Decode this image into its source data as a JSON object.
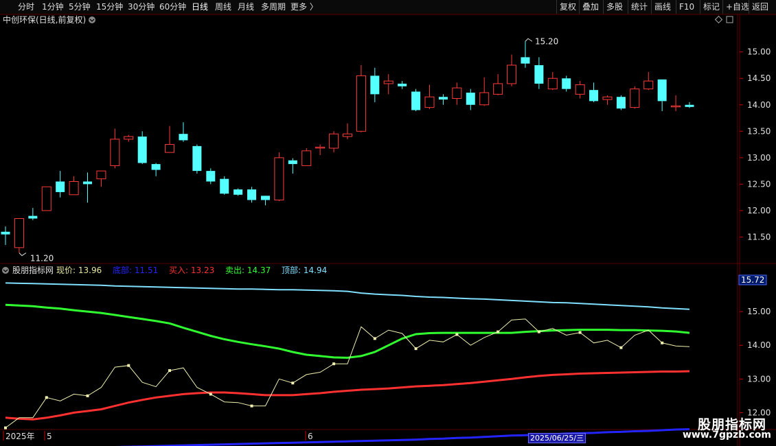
{
  "toolbar": {
    "left": [
      "分时",
      "1分钟",
      "5分钟",
      "15分钟",
      "30分钟",
      "60分钟",
      "日线",
      "周线",
      "月线",
      "多周期",
      "更多 〉"
    ],
    "active_index": 6,
    "right": [
      "复权",
      "叠加",
      "多股",
      "统计",
      "画线",
      "F10",
      "标记",
      "+自选",
      "返回"
    ]
  },
  "stock": {
    "title": "中创环保(日线,前复权)",
    "high_marker": "15.20",
    "low_marker": "11.20"
  },
  "indicator": {
    "name": "股朋指标网",
    "items": [
      {
        "label": "现价:",
        "value": "13.96",
        "color": "#e8e8a0"
      },
      {
        "label": "底部:",
        "value": "11.51",
        "color": "#2424ff"
      },
      {
        "label": "买入:",
        "value": "13.23",
        "color": "#ff3030"
      },
      {
        "label": "卖出:",
        "value": "14.37",
        "color": "#30ff30"
      },
      {
        "label": "顶部:",
        "value": "14.94",
        "color": "#80e0ff"
      }
    ],
    "current_badge": "15.72"
  },
  "axis": {
    "date_labels": [
      "2025年",
      "5",
      "6"
    ],
    "date_badge": "2025/06/25/三"
  },
  "brand": {
    "name": "股朋指标网",
    "url": "www.7gpzb.com"
  },
  "colors": {
    "up": "#ff3a3a",
    "down": "#54ffff",
    "grid": "#5a0000",
    "bg": "#000000"
  },
  "chart_data": {
    "type": "candlestick",
    "price_axis": {
      "ticks": [
        11.5,
        12.0,
        12.5,
        13.0,
        13.5,
        14.0,
        14.5,
        15.0
      ],
      "range": [
        11.0,
        15.45
      ]
    },
    "indicator_axis": {
      "ticks": [
        12.0,
        13.0,
        14.0,
        15.0
      ],
      "range": [
        11.5,
        16.0
      ]
    },
    "candles": [
      [
        11.6,
        11.55,
        11.7,
        11.35
      ],
      [
        11.3,
        11.85,
        11.85,
        11.2
      ],
      [
        11.9,
        11.85,
        12.05,
        11.82
      ],
      [
        12.0,
        12.45,
        12.45,
        12.0
      ],
      [
        12.55,
        12.35,
        12.75,
        12.25
      ],
      [
        12.3,
        12.55,
        12.65,
        12.3
      ],
      [
        12.55,
        12.5,
        12.72,
        12.15
      ],
      [
        12.6,
        12.75,
        12.75,
        12.45
      ],
      [
        12.85,
        13.35,
        13.55,
        12.8
      ],
      [
        13.35,
        13.4,
        13.43,
        13.3
      ],
      [
        13.4,
        12.9,
        13.5,
        12.88
      ],
      [
        12.88,
        12.77,
        12.9,
        12.65
      ],
      [
        13.1,
        13.25,
        13.6,
        13.1
      ],
      [
        13.45,
        13.33,
        13.67,
        13.3
      ],
      [
        13.22,
        12.75,
        13.25,
        12.7
      ],
      [
        12.75,
        12.55,
        12.8,
        12.5
      ],
      [
        12.6,
        12.32,
        12.65,
        12.3
      ],
      [
        12.4,
        12.3,
        12.42,
        12.28
      ],
      [
        12.4,
        12.2,
        12.45,
        12.15
      ],
      [
        12.28,
        12.2,
        12.28,
        12.1
      ],
      [
        12.2,
        13.0,
        13.1,
        12.18
      ],
      [
        12.95,
        12.88,
        12.99,
        12.7
      ],
      [
        12.85,
        13.13,
        13.18,
        12.85
      ],
      [
        13.2,
        13.2,
        13.25,
        13.05
      ],
      [
        13.18,
        13.45,
        13.5,
        13.1
      ],
      [
        13.4,
        13.45,
        13.65,
        13.35
      ],
      [
        13.5,
        14.55,
        14.75,
        13.48
      ],
      [
        14.55,
        14.2,
        14.7,
        14.05
      ],
      [
        14.4,
        14.45,
        14.58,
        14.2
      ],
      [
        14.4,
        14.35,
        14.45,
        14.3
      ],
      [
        14.25,
        13.9,
        14.3,
        13.88
      ],
      [
        13.95,
        14.15,
        14.38,
        13.92
      ],
      [
        14.15,
        14.1,
        14.2,
        14.0
      ],
      [
        14.12,
        14.32,
        14.42,
        14.0
      ],
      [
        14.23,
        14.0,
        14.3,
        13.9
      ],
      [
        14.0,
        14.23,
        14.52,
        13.98
      ],
      [
        14.2,
        14.4,
        14.58,
        14.18
      ],
      [
        14.4,
        14.75,
        14.95,
        14.35
      ],
      [
        14.9,
        14.78,
        15.2,
        14.7
      ],
      [
        14.75,
        14.4,
        14.9,
        14.3
      ],
      [
        14.3,
        14.5,
        14.62,
        14.28
      ],
      [
        14.5,
        14.3,
        14.55,
        14.25
      ],
      [
        14.2,
        14.38,
        14.45,
        14.12
      ],
      [
        14.28,
        14.07,
        14.42,
        14.05
      ],
      [
        14.1,
        14.15,
        14.18,
        14.0
      ],
      [
        14.15,
        13.93,
        14.18,
        13.9
      ],
      [
        13.95,
        14.3,
        14.35,
        13.93
      ],
      [
        14.3,
        14.45,
        14.62,
        14.28
      ],
      [
        14.48,
        14.07,
        14.48,
        13.88
      ],
      [
        13.98,
        13.98,
        14.18,
        13.88
      ],
      [
        14.0,
        13.96,
        14.05,
        13.94
      ]
    ],
    "series": [
      {
        "name": "顶部",
        "color": "#80e0ff",
        "values": [
          15.85,
          15.84,
          15.83,
          15.82,
          15.81,
          15.8,
          15.79,
          15.78,
          15.76,
          15.75,
          15.74,
          15.73,
          15.72,
          15.71,
          15.7,
          15.69,
          15.68,
          15.67,
          15.67,
          15.66,
          15.65,
          15.65,
          15.64,
          15.63,
          15.62,
          15.6,
          15.55,
          15.52,
          15.5,
          15.48,
          15.45,
          15.43,
          15.42,
          15.4,
          15.38,
          15.37,
          15.35,
          15.33,
          15.31,
          15.29,
          15.27,
          15.26,
          15.24,
          15.22,
          15.2,
          15.18,
          15.16,
          15.14,
          15.11,
          15.09,
          15.07
        ]
      },
      {
        "name": "卖出",
        "color": "#30ff30",
        "values": [
          15.2,
          15.18,
          15.16,
          15.12,
          15.09,
          15.04,
          15.0,
          14.96,
          14.9,
          14.84,
          14.78,
          14.72,
          14.65,
          14.52,
          14.4,
          14.28,
          14.18,
          14.1,
          14.03,
          13.97,
          13.9,
          13.8,
          13.72,
          13.68,
          13.64,
          13.63,
          13.68,
          13.8,
          14.0,
          14.2,
          14.33,
          14.36,
          14.37,
          14.37,
          14.37,
          14.37,
          14.37,
          14.37,
          14.4,
          14.42,
          14.44,
          14.45,
          14.46,
          14.46,
          14.46,
          14.45,
          14.45,
          14.44,
          14.43,
          14.41,
          14.37
        ]
      },
      {
        "name": "买入",
        "color": "#ff3030",
        "values": [
          11.85,
          11.82,
          11.8,
          11.85,
          11.92,
          12.0,
          12.05,
          12.1,
          12.2,
          12.3,
          12.38,
          12.45,
          12.5,
          12.55,
          12.58,
          12.6,
          12.6,
          12.58,
          12.55,
          12.52,
          12.52,
          12.52,
          12.55,
          12.58,
          12.62,
          12.65,
          12.68,
          12.7,
          12.72,
          12.75,
          12.78,
          12.8,
          12.82,
          12.85,
          12.88,
          12.92,
          12.96,
          13.0,
          13.05,
          13.09,
          13.12,
          13.14,
          13.16,
          13.17,
          13.18,
          13.19,
          13.2,
          13.21,
          13.22,
          13.22,
          13.23
        ]
      },
      {
        "name": "底部",
        "color": "#2424ff",
        "values": [
          10.9,
          10.91,
          10.92,
          10.93,
          10.94,
          10.95,
          10.96,
          10.97,
          10.98,
          10.99,
          11.0,
          11.01,
          11.02,
          11.03,
          11.04,
          11.05,
          11.06,
          11.07,
          11.08,
          11.09,
          11.1,
          11.11,
          11.12,
          11.13,
          11.14,
          11.15,
          11.16,
          11.17,
          11.18,
          11.19,
          11.2,
          11.22,
          11.23,
          11.25,
          11.26,
          11.28,
          11.3,
          11.32,
          11.33,
          11.35,
          11.36,
          11.38,
          11.39,
          11.4,
          11.42,
          11.43,
          11.45,
          11.46,
          11.48,
          11.5,
          11.51
        ]
      }
    ]
  }
}
